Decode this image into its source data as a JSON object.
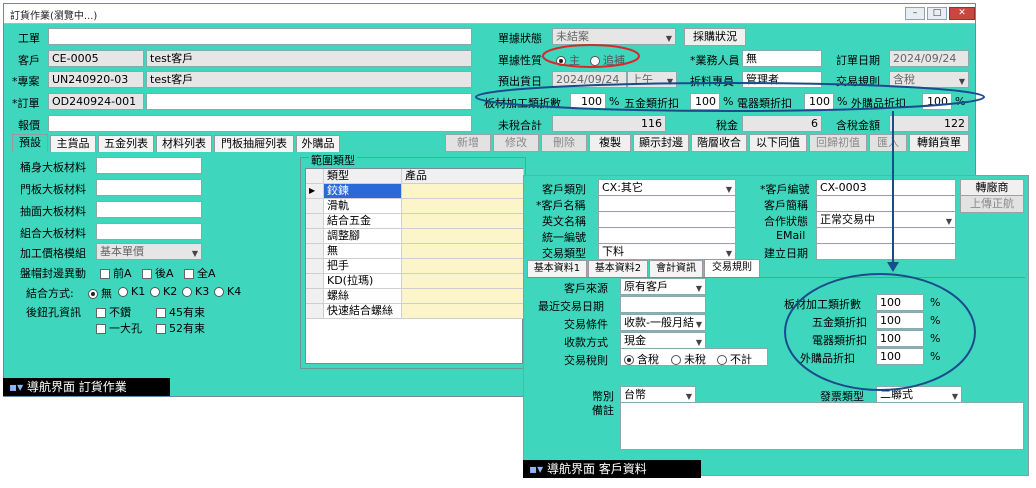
{
  "window": {
    "title": "訂貨作業(瀏覽中...)",
    "controls": [
      "–",
      "□",
      "✕"
    ]
  },
  "header_left": {
    "work_label": "工單",
    "work_value": "",
    "customer_label": "客戶",
    "customer_code": "CE-0005",
    "customer_name": "test客戶",
    "project_label": "*專案",
    "project_code": "UN240920-03",
    "project_name": "test客戶",
    "order_label": "*訂單",
    "order_code": "OD240924-001",
    "order_extra": "",
    "quote_label": "報價",
    "quote_value": ""
  },
  "header_right": {
    "doc_status_label": "單據狀態",
    "doc_status_value": "未結案",
    "purchase_btn": "採購狀況",
    "doc_nature_label": "單據性質",
    "nature_main": "主",
    "nature_supp": "追補",
    "sales_label": "*業務人員",
    "sales_value": "無",
    "order_date_label": "訂單日期",
    "order_date_value": "2024/09/24",
    "out_date_label": "預出貨日",
    "out_date_value": "2024/09/24",
    "out_ampm": "上午",
    "material_staff_label": "拆料專員",
    "material_staff_value": "管理者",
    "trade_rule_label": "交易規則",
    "trade_rule_value": "含稅",
    "board_disc_label": "板材加工類折數",
    "board_disc": "100",
    "hardware_disc_label": "五金類折扣",
    "hardware_disc": "100",
    "electric_disc_label": "電器類折扣",
    "electric_disc": "100",
    "outsource_disc_label": "外購品折扣",
    "outsource_disc": "100",
    "pct": "%",
    "untaxed_label": "未稅合計",
    "untaxed_value": "116",
    "tax_label": "稅金",
    "tax_value": "6",
    "taxed_label": "含稅金額",
    "taxed_value": "122"
  },
  "tabs": [
    "預設",
    "主貨品",
    "五金列表",
    "材料列表",
    "門板抽屜列表",
    "外購品"
  ],
  "toolbar": [
    "新增",
    "修改",
    "刪除",
    "複製",
    "顯示封邊",
    "階層收合",
    "以下同值",
    "回歸初值",
    "匯入",
    "轉銷貨單"
  ],
  "left_panel": {
    "cabinet_board": "桶身大板材料",
    "door_board": "門板大板材料",
    "drawer_board": "抽面大板材料",
    "combo_board": "組合大板材料",
    "price_module_label": "加工價格模組",
    "price_module_value": "基本單價",
    "edge_label": "盤帽封邊異動",
    "edge_front": "前A",
    "edge_back": "後A",
    "edge_all": "全A",
    "combo_label": "結合方式:",
    "combo_opts": [
      "無",
      "K1",
      "K2",
      "K3",
      "K4"
    ],
    "hole_label": "後鈕孔資訊",
    "hole_opts": [
      "不鑽",
      "45有束",
      "一大孔",
      "52有束"
    ]
  },
  "range_group": {
    "title": "範圍類型",
    "col_type": "類型",
    "col_product": "產品",
    "rows": [
      "鉸鍊",
      "滑軌",
      "結合五金",
      "調整腳",
      "無",
      "把手",
      "KD(拉瑪)",
      "螺絲",
      "快速結合螺絲"
    ]
  },
  "status_main": {
    "icon": "▪▾",
    "text": "導航界面  訂貨作業"
  },
  "popup": {
    "cust_type_label": "客戶類別",
    "cust_type_value": "CX:其它",
    "cust_code_label": "*客戶編號",
    "cust_code_value": "CX-0003",
    "btn_to_vendor": "轉廠商",
    "btn_upload": "上傳正航",
    "cust_name_label": "*客戶名稱",
    "cust_name_value": "",
    "cust_short_label": "客戶簡稱",
    "cust_short_value": "",
    "en_name_label": "英文名稱",
    "en_name_value": "",
    "coop_label": "合作狀態",
    "coop_value": "正常交易中",
    "tax_id_label": "統一編號",
    "tax_id_value": "",
    "email_label": "EMail",
    "email_value": "",
    "trade_type_label": "交易類型",
    "trade_type_value": "下料",
    "created_label": "建立日期",
    "created_value": "",
    "tabs": [
      "基本資料1",
      "基本資料2",
      "會計資訊",
      "交易規則"
    ],
    "source_label": "客戶來源",
    "source_value": "原有客戶",
    "last_trade_label": "最近交易日期",
    "last_trade_value": "",
    "terms_label": "交易條件",
    "terms_value": "收款-一般月結",
    "pay_label": "收款方式",
    "pay_value": "現金",
    "rule_label": "交易稅則",
    "rule_opts": [
      "含稅",
      "未稅",
      "不計"
    ],
    "board_disc_label": "板材加工類折數",
    "board_disc": "100",
    "hw_disc_label": "五金類折扣",
    "hw_disc": "100",
    "elec_disc_label": "電器類折扣",
    "elec_disc": "100",
    "out_disc_label": "外購品折扣",
    "out_disc": "100",
    "pct": "%",
    "currency_label": "幣別",
    "currency_value": "台幣",
    "invoice_label": "發票類型",
    "invoice_value": "二聯式",
    "note_label": "備註",
    "note_value": ""
  },
  "status_popup": {
    "icon": "▪▾",
    "text": "導航界面  客戶資料"
  },
  "colors": {
    "panel": "#3fd6be",
    "highlight": "#2b68d8",
    "annotation": "#1a4c8c",
    "annotation_red": "#d42a2a"
  }
}
